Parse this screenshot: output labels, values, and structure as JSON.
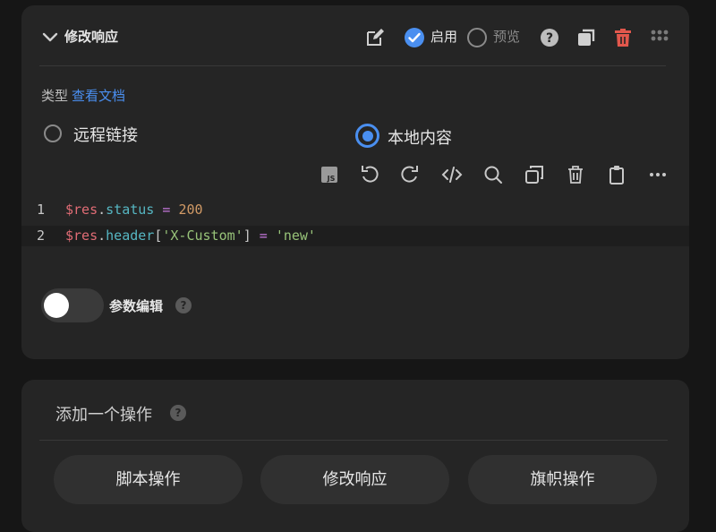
{
  "main_card": {
    "title": "修改响应",
    "enable_label": "启用",
    "enabled": true,
    "preview_label": "预览",
    "preview": false,
    "icons": {
      "collapse": "chevron-down-icon",
      "edit": "edit-icon",
      "help": "help-icon",
      "duplicate": "duplicate-icon",
      "delete": "trash-icon",
      "drag": "drag-grid-icon"
    },
    "colors": {
      "accent": "#4a8ff0",
      "danger": "#e2574c"
    }
  },
  "type_section": {
    "label": "类型",
    "docs_link": "查看文档",
    "options": [
      {
        "label": "远程链接",
        "selected": false
      },
      {
        "label": "本地内容",
        "selected": true
      }
    ]
  },
  "editor": {
    "toolbar": [
      "js-icon",
      "undo-icon",
      "redo-icon",
      "code-icon",
      "search-icon",
      "copy-icon",
      "trash-icon",
      "clipboard-icon",
      "more-icon"
    ],
    "lines": [
      {
        "number": "1",
        "var": "$res",
        "dot": ".",
        "prop": "status",
        "op": " = ",
        "num": "200"
      },
      {
        "number": "2",
        "var": "$res",
        "dot": ".",
        "prop": "header",
        "br_open": "[",
        "str": "'X-Custom'",
        "br_close": "]",
        "op": " = ",
        "val": "'new'"
      }
    ]
  },
  "param_edit": {
    "label": "参数编辑",
    "enabled": false,
    "help": "?"
  },
  "add_section": {
    "title": "添加一个操作",
    "help": "?",
    "buttons": [
      "脚本操作",
      "修改响应",
      "旗帜操作"
    ]
  }
}
